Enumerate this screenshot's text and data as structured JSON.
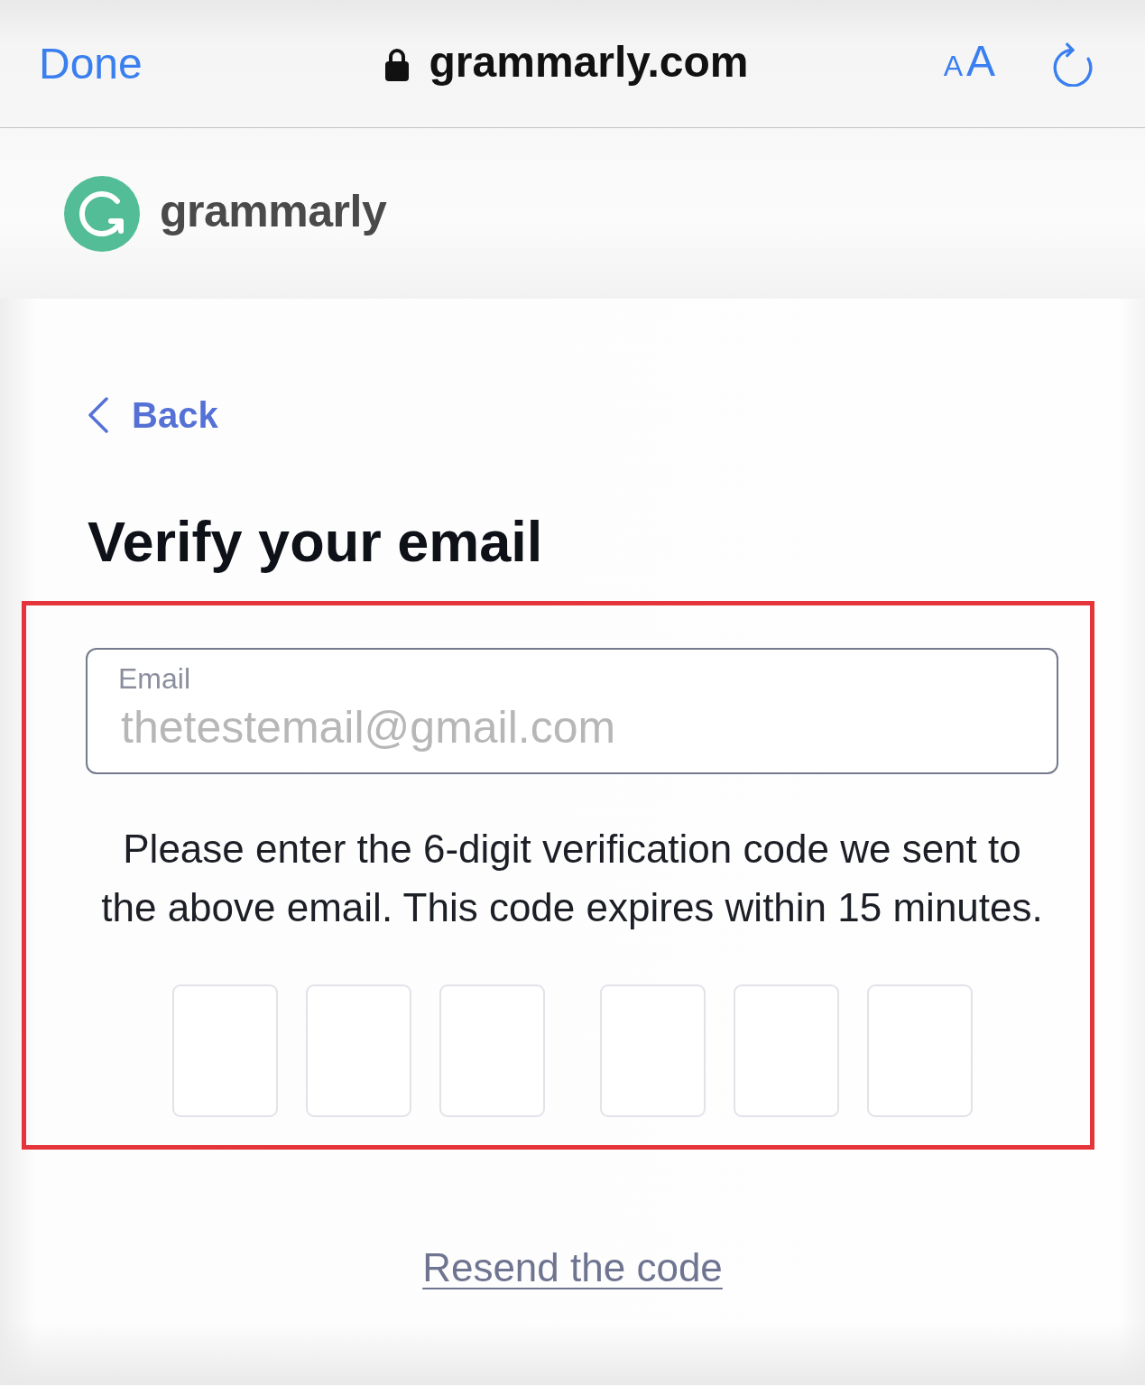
{
  "browser_bar": {
    "done_label": "Done",
    "secure": true,
    "url": "grammarly.com",
    "text_size_label": "AA"
  },
  "site_header": {
    "logo_text": "grammarly"
  },
  "back_link": "Back",
  "title": "Verify your email",
  "verification": {
    "highlighted": true,
    "email_field": {
      "label": "Email",
      "value": "thetestemail@gmail.com",
      "disabled": true
    },
    "instructions": "Please enter the 6-digit verification code we sent to the above email. This code expires within 15 minutes.",
    "code_groups": [
      {
        "boxes": [
          {
            "focused": false
          },
          {
            "focused": false
          },
          {
            "focused": false
          }
        ]
      },
      {
        "boxes": [
          {
            "focused": false
          },
          {
            "focused": false
          },
          {
            "focused": false
          }
        ]
      }
    ]
  },
  "resend_link": "Resend the code"
}
